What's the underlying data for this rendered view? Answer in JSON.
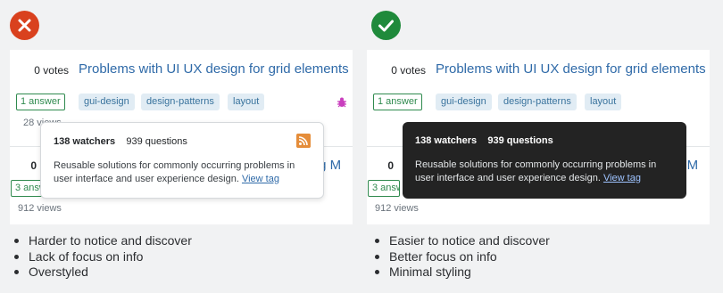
{
  "question": {
    "votes": "0 votes",
    "title": "Problems with UI UX design for grid elements",
    "answers": "1 answer",
    "tags": [
      "gui-design",
      "design-patterns",
      "layout"
    ]
  },
  "question2": {
    "votes": "0",
    "answers": "3 answers",
    "views": "912 views",
    "title_partial": "ming M"
  },
  "left_panel": {
    "views_partial": "28 views"
  },
  "tooltip": {
    "watchers": "138 watchers",
    "questions": "939 questions",
    "description": "Reusable solutions for commonly occurring problems in user interface and user experience design.",
    "link": "View tag"
  },
  "bad_points": [
    "Harder to notice and discover",
    "Lack of focus on info",
    "Overstyled"
  ],
  "good_points": [
    "Easier to notice and discover",
    "Better focus on info",
    "Minimal styling"
  ],
  "colors": {
    "bad": "#d9411e",
    "good": "#1f8a3b",
    "link": "#2f6aa8",
    "dark_tooltip": "#232323"
  },
  "icons": [
    "x-icon",
    "check-icon",
    "rss-icon",
    "bug-icon"
  ]
}
